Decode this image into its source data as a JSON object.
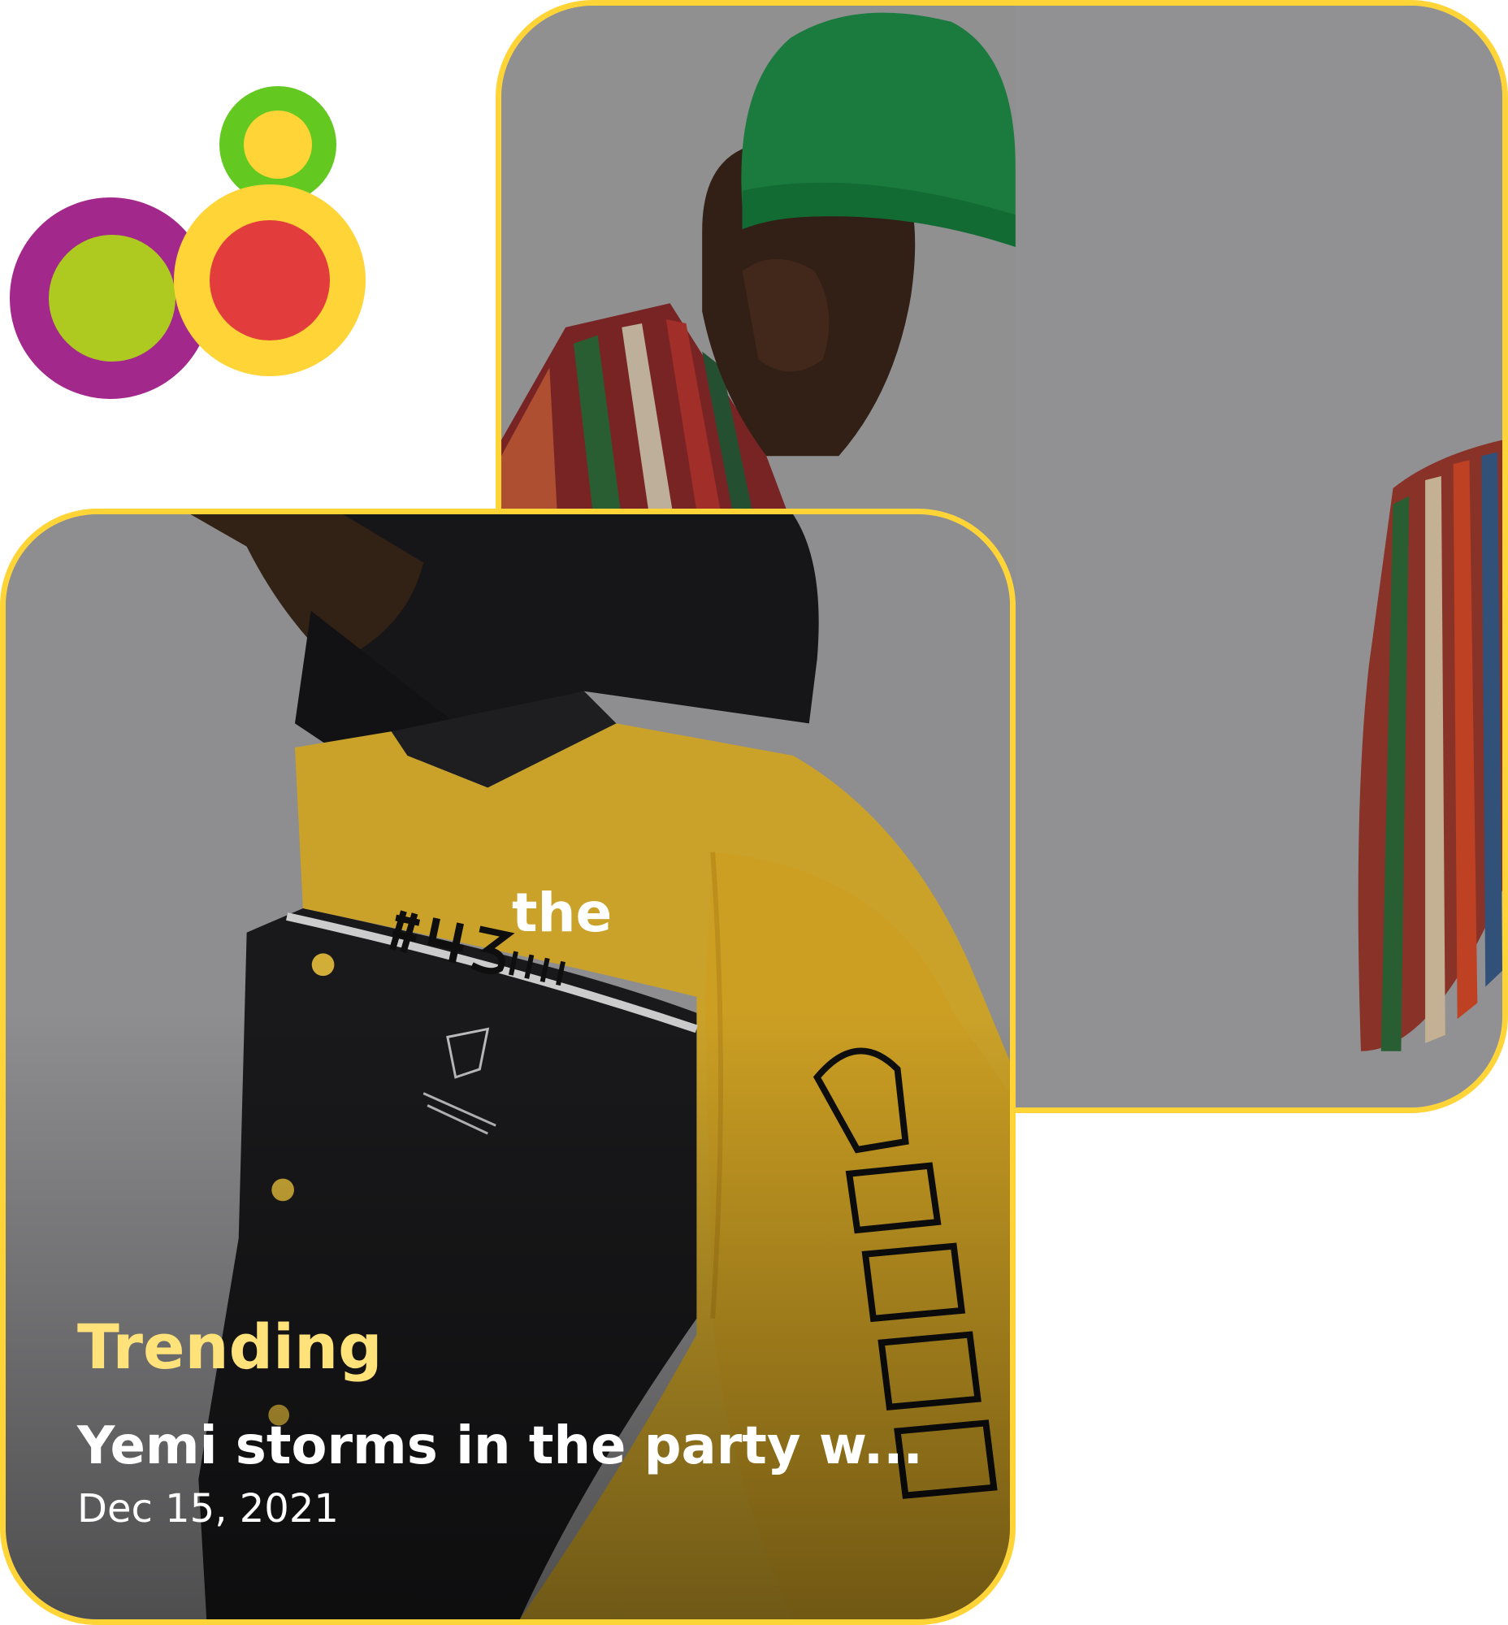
{
  "brand": {
    "logo_icon": "four-circles-logo",
    "colors": {
      "purple": "#A3288C",
      "lime": "#AEC91F",
      "yellow": "#FFD437",
      "red": "#E23C3C",
      "green": "#63C820",
      "card_border": "#FFD437"
    }
  },
  "cards": {
    "back": {
      "image": "man-green-beanie-striped-shirt-photo",
      "peek_text": "the"
    },
    "front": {
      "image": "yellow-black-varsity-jacket-photo",
      "category": "Trending",
      "headline": "Yemi storms in the party w...",
      "date": "Dec 15, 2021"
    }
  }
}
